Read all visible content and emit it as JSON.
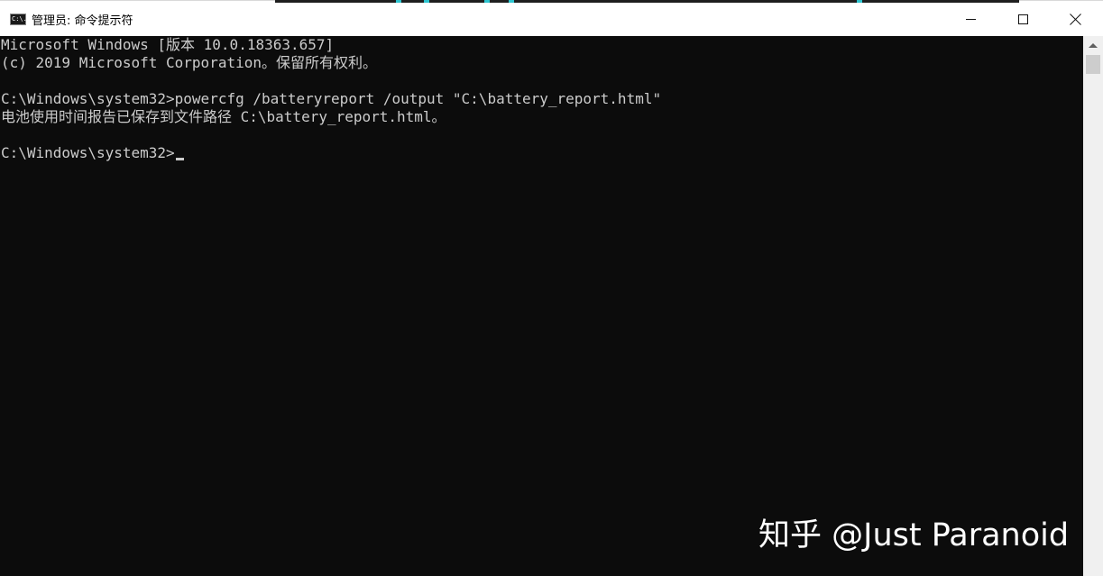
{
  "window": {
    "title": "管理员: 命令提示符",
    "icon": "cmd-icon",
    "icon_label": "C:\\."
  },
  "console": {
    "lines": [
      "Microsoft Windows [版本 10.0.18363.657]",
      "(c) 2019 Microsoft Corporation。保留所有权利。",
      "",
      "C:\\Windows\\system32>powercfg /batteryreport /output \"C:\\battery_report.html\"",
      "电池使用时间报告已保存到文件路径 C:\\battery_report.html。",
      "",
      "C:\\Windows\\system32>"
    ]
  },
  "watermark": "知乎 @Just Paranoid",
  "colors": {
    "console_bg": "#0c0c0c",
    "console_text": "#cccccc",
    "titlebar_bg": "#ffffff"
  }
}
